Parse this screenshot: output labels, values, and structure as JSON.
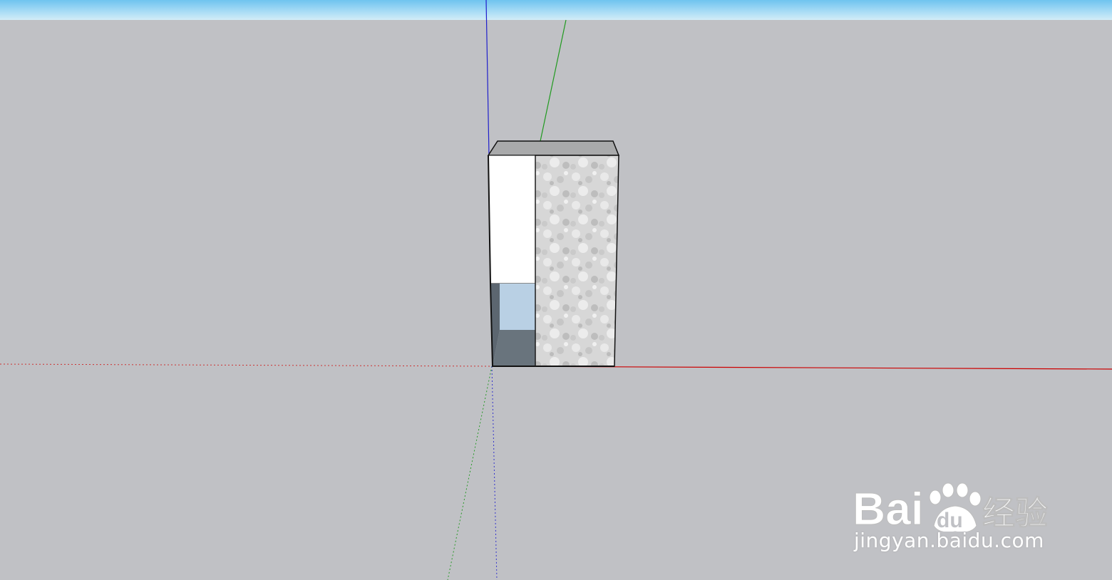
{
  "viewport": {
    "sky_color": "#8ccff2",
    "ground_color": "#c0c1c5"
  },
  "axes": {
    "red_axis_color": "#cc0000",
    "green_axis_color": "#1f9a1f",
    "blue_axis_color": "#1f1fcc"
  },
  "model": {
    "name": "box-model",
    "top_face_color": "#a9aaab",
    "front_face_color": "#ffffff",
    "textured_face_color": "#d8d8d8",
    "glass_color": "#b9d0e4",
    "shadow_color": "#69747d"
  },
  "watermark": {
    "logo_text": "Bai",
    "logo_text_2": "du",
    "logo_cn": "经验",
    "url": "jingyan.baidu.com"
  }
}
